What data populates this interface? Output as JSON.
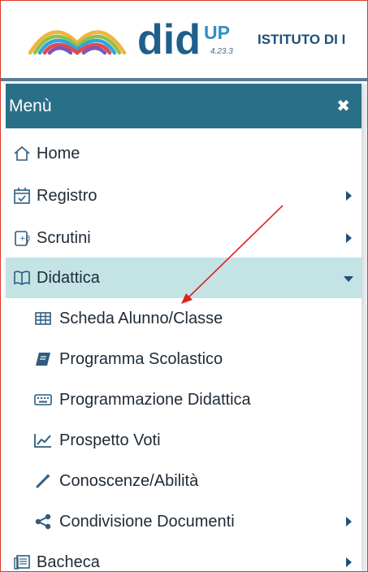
{
  "brand": {
    "name": "did",
    "super": "UP",
    "version": "4.23.3",
    "school": "ISTITUTO DI I"
  },
  "menu": {
    "title": "Menù",
    "close_icon": "close-icon",
    "items": [
      {
        "label": "Home",
        "icon": "home-icon"
      },
      {
        "label": "Registro",
        "icon": "calendar-icon",
        "expandable": true
      },
      {
        "label": "Scrutini",
        "icon": "scrutini-icon",
        "expandable": true
      },
      {
        "label": "Didattica",
        "icon": "book-open-icon",
        "expanded": true,
        "active": true
      },
      {
        "label": "Scheda Alunno/Classe",
        "icon": "table-icon"
      },
      {
        "label": "Programma Scolastico",
        "icon": "book-icon"
      },
      {
        "label": "Programmazione Didattica",
        "icon": "keyboard-icon"
      },
      {
        "label": "Prospetto Voti",
        "icon": "chart-line-icon"
      },
      {
        "label": "Conoscenze/Abilità",
        "icon": "magic-wand-icon"
      },
      {
        "label": "Condivisione Documenti",
        "icon": "share-icon",
        "expandable": true
      },
      {
        "label": "Bacheca",
        "icon": "bulletin-icon",
        "expandable": true
      }
    ]
  },
  "colors": {
    "menu_header": "#2a6f88",
    "active_bg": "#c3e3e5",
    "arrow": "#e0201a",
    "frame_border": "#d93a2b"
  }
}
